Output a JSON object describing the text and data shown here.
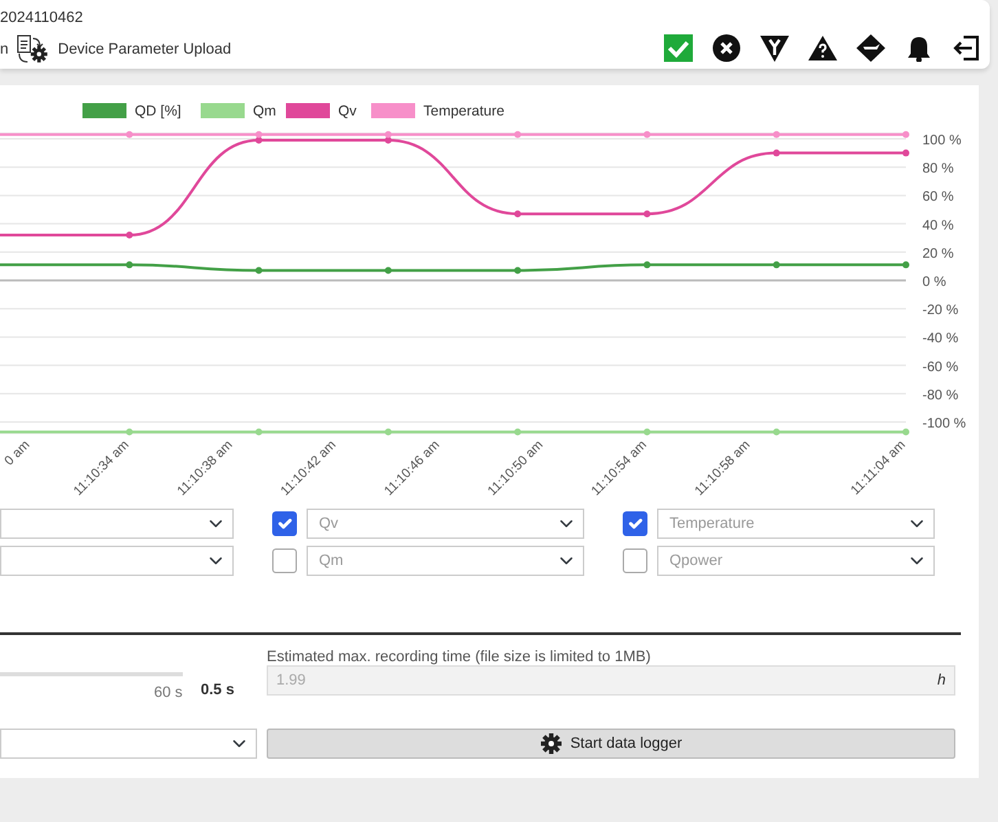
{
  "header": {
    "serial": "2024110462",
    "menu": [
      {
        "kind": "text",
        "label": "n"
      },
      {
        "kind": "upload",
        "label": "Device Parameter Upload"
      }
    ]
  },
  "chart": {
    "cut_tick_label": "0 am",
    "chart_data": {
      "type": "line",
      "x": [
        40229,
        40234,
        40239,
        40244,
        40249,
        40254,
        40259,
        40264
      ],
      "xlim": [
        40229,
        40264
      ],
      "ylim": [
        -108,
        104
      ],
      "grid": true,
      "legend": true,
      "xticks": [
        {
          "value": 40234,
          "label": "11:10:34 am"
        },
        {
          "value": 40238,
          "label": "11:10:38 am"
        },
        {
          "value": 40242,
          "label": "11:10:42 am"
        },
        {
          "value": 40246,
          "label": "11:10:46 am"
        },
        {
          "value": 40250,
          "label": "11:10:50 am"
        },
        {
          "value": 40254,
          "label": "11:10:54 am"
        },
        {
          "value": 40258,
          "label": "11:10:58 am"
        },
        {
          "value": 40264,
          "label": "11:11:04 am"
        }
      ],
      "yticks": [
        {
          "value": 100,
          "label": "100 %"
        },
        {
          "value": 80,
          "label": "80 %"
        },
        {
          "value": 60,
          "label": "60 %"
        },
        {
          "value": 40,
          "label": "40 %"
        },
        {
          "value": 20,
          "label": "20 %"
        },
        {
          "value": 0,
          "label": "0 %"
        },
        {
          "value": -20,
          "label": "-20 %"
        },
        {
          "value": -40,
          "label": "-40 %"
        },
        {
          "value": -60,
          "label": "-60 %"
        },
        {
          "value": -80,
          "label": "-80 %"
        },
        {
          "value": -100,
          "label": "-100 %"
        }
      ],
      "series": [
        {
          "name": "QD [%]",
          "color": "#43a047",
          "marker": "circle",
          "values": [
            11,
            11,
            7,
            7,
            7,
            11,
            11,
            11
          ]
        },
        {
          "name": "Qm",
          "color": "#98d98e",
          "marker": "circle",
          "values": [
            -107,
            -107,
            -107,
            -107,
            -107,
            -107,
            -107,
            -107
          ]
        },
        {
          "name": "Qv",
          "color": "#e0489a",
          "marker": "circle",
          "values": [
            32,
            32,
            99,
            99,
            47,
            47,
            90,
            90
          ]
        },
        {
          "name": "Temperature",
          "color": "#f78fc9",
          "marker": "circle",
          "values": [
            103,
            103,
            103,
            103,
            103,
            103,
            103,
            103
          ]
        }
      ]
    }
  },
  "selectors": [
    {
      "items": [
        {
          "kind": "select"
        },
        {
          "kind": "select"
        }
      ]
    },
    {
      "items": [
        {
          "kind": "checked-select",
          "checked": true,
          "value": "Qv"
        },
        {
          "kind": "checked-select",
          "checked": false,
          "value": "Qm"
        }
      ]
    },
    {
      "items": [
        {
          "kind": "checked-select",
          "checked": true,
          "value": "Temperature"
        },
        {
          "kind": "checked-select",
          "checked": false,
          "value": "Qpower"
        }
      ]
    }
  ],
  "logger": {
    "interval": {
      "max_label": "60 s",
      "value": "0.5 s"
    },
    "estimate": {
      "label": "Estimated max. recording time (file size is limited to 1MB)",
      "value": "1.99",
      "unit": "h"
    },
    "start_button": {
      "label": "Start data logger"
    }
  }
}
